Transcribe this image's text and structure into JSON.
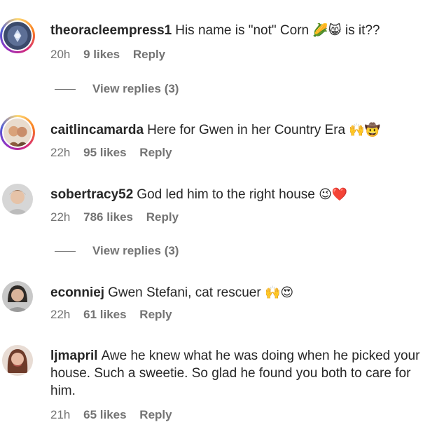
{
  "comments": [
    {
      "username": "theoracleempress1",
      "text": "His name is \"not\" Corn",
      "emoji": "🌽😸",
      "text_after": "is it??",
      "time": "20h",
      "likes": "9 likes",
      "reply": "Reply",
      "view_replies": "View replies (3)"
    },
    {
      "username": "caitlincamarda",
      "text": "Here for Gwen in her Country Era",
      "emoji": "🙌🤠",
      "time": "22h",
      "likes": "95 likes",
      "reply": "Reply"
    },
    {
      "username": "sobertracy52",
      "text": "God led him to the right house",
      "emoji": "😉❤️",
      "time": "22h",
      "likes": "786 likes",
      "reply": "Reply",
      "view_replies": "View replies (3)"
    },
    {
      "username": "econniej",
      "text": "Gwen Stefani, cat rescuer",
      "emoji": "🙌😍",
      "time": "22h",
      "likes": "61 likes",
      "reply": "Reply"
    },
    {
      "username": "ljmapril",
      "text": "Awe he knew what he was doing when he picked your house. Such a sweetie. So glad he found you both to care for him.",
      "time": "21h",
      "likes": "65 likes",
      "reply": "Reply"
    }
  ]
}
